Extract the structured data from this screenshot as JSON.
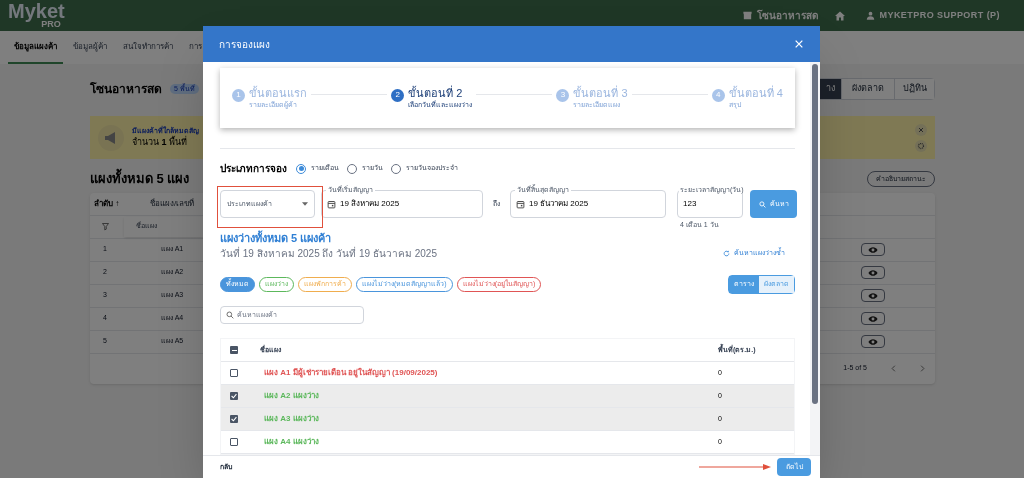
{
  "app": {
    "logo": "Myket",
    "logo_sub": "PRO",
    "zone": "โซนอาหารสด",
    "user": "MYKETPRO SUPPORT (P)"
  },
  "tabs": [
    {
      "label": "ข้อมูลแผงค้า",
      "selected": true
    },
    {
      "label": "ข้อมูลผู้ค้า",
      "selected": false
    },
    {
      "label": "สนใจทำการค้า",
      "selected": false
    },
    {
      "label": "การ",
      "selected": false
    }
  ],
  "page": {
    "title": "โซนอาหารสด",
    "badge": "5 พื้นที่",
    "views": [
      {
        "label": "าง",
        "selected": true
      },
      {
        "label": "ผังตลาด",
        "selected": false
      },
      {
        "label": "ปฏิทิน",
        "selected": false
      }
    ],
    "alert": {
      "title": "มีแผงค้าที่ใกล้หมดสัญ",
      "text": "จำนวน **1** พื้นที่"
    },
    "stalls_heading": "แผงทั้งหมด 5 แผง",
    "legend_button": "คำอธิบายสถานะ",
    "table": {
      "columns": [
        "ลำดับ ↑",
        "ชื่อแผง/เลขที่"
      ],
      "filter_placeholder": "ชื่อแผง",
      "rows": [
        {
          "index": "1",
          "name": "แผง A1"
        },
        {
          "index": "2",
          "name": "แผง A2"
        },
        {
          "index": "3",
          "name": "แผง A3"
        },
        {
          "index": "4",
          "name": "แผง A4"
        },
        {
          "index": "5",
          "name": "แผง A5"
        }
      ],
      "pagination": "1-5 of 5"
    }
  },
  "modal": {
    "title": "การจองแผง",
    "steps": [
      {
        "number": "1",
        "title": "ขั้นตอนแรก",
        "subtitle": "รายละเอียดผู้ค้า",
        "selected": false
      },
      {
        "number": "2",
        "title": "ขั้นตอนที่ 2",
        "subtitle": "เลือกวันที่และแผงว่าง",
        "selected": true
      },
      {
        "number": "3",
        "title": "ขั้นตอนที่ 3",
        "subtitle": "รายละเอียดแผง",
        "selected": false
      },
      {
        "number": "4",
        "title": "ขั้นตอนที่ 4",
        "subtitle": "สรุป",
        "selected": false
      }
    ],
    "booking_type": {
      "label": "ประเภทการจอง",
      "options": [
        {
          "label": "รายเดือน",
          "selected": true
        },
        {
          "label": "รายวัน",
          "selected": false
        },
        {
          "label": "รายวันจองประจำ",
          "selected": false
        }
      ]
    },
    "stall_type": {
      "placeholder": "ประเภทแผงค้า"
    },
    "start_date": {
      "label": "วันที่เริ่มสัญญา",
      "value": "19 สิงหาคม 2025"
    },
    "to": "ถึง",
    "end_date": {
      "label": "วันที่สิ้นสุดสัญญา",
      "value": "19 ธันวาคม 2025"
    },
    "duration": {
      "label": "ระยะเวลาสัญญา(วัน)",
      "value": "123",
      "hint": "4 เดือน 1 วัน"
    },
    "search_button": "ค้นหา",
    "result_title": "แผงว่างทั้งหมด 5 แผงค้า",
    "result_dates": "วันที่ 19 สิงหาคม 2025 ถึง วันที่ 19 ธันวาคม 2025",
    "research_link": "ค้นหาแผงว่างซ้ำ",
    "filters": [
      {
        "label": "ทั้งหมด",
        "color": "#4a95dc",
        "selected": true
      },
      {
        "label": "แผงว่าง",
        "color": "#5cb85c",
        "selected": false
      },
      {
        "label": "แผงพักการค้า",
        "color": "#f0ad4e",
        "selected": false
      },
      {
        "label": "แผงไม่ว่าง(หมดสัญญาแล้ว)",
        "color": "#4a95dc",
        "selected": false
      },
      {
        "label": "แผงไม่ว่าง(อยู่ในสัญญา)",
        "color": "#e05555",
        "selected": false
      }
    ],
    "view_toggle": [
      {
        "label": "ตาราง",
        "selected": true
      },
      {
        "label": "ผังตลาด",
        "selected": false
      }
    ],
    "stall_search": {
      "placeholder": "ค้นหาแผงค้า"
    },
    "table": {
      "select_all_partial": true,
      "columns": [
        "ชื่อแผง",
        "พื้นที่(ตร.ม.)"
      ],
      "rows": [
        {
          "name": "แผง A1 มีผู้เช่ารายเดือน อยู่ในสัญญา (19/09/2025)",
          "color": "#e05555",
          "area": "0",
          "checked": false
        },
        {
          "name": "แผง A2 แผงว่าง",
          "color": "#5cb85c",
          "area": "0",
          "checked": true
        },
        {
          "name": "แผง A3 แผงว่าง",
          "color": "#5cb85c",
          "area": "0",
          "checked": true
        },
        {
          "name": "แผง A4 แผงว่าง",
          "color": "#5cb85c",
          "area": "0",
          "checked": false
        }
      ]
    },
    "back_button": "กลับ",
    "next_button": "ถัดไป"
  }
}
